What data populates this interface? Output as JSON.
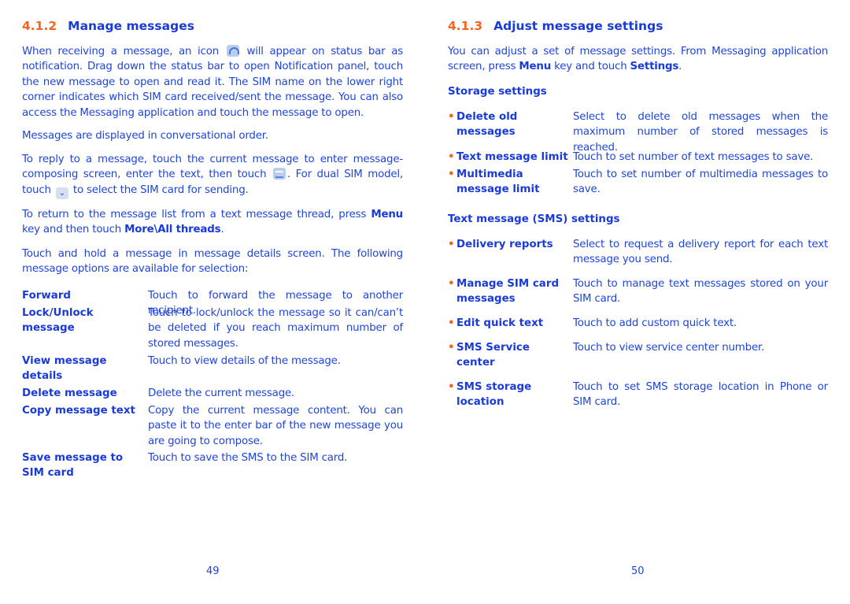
{
  "left_page": {
    "section_number": "4.1.2",
    "section_title": "Manage messages",
    "para1_before_icon": "When receiving a message, an icon",
    "para1_icon": "new-message-icon",
    "para1_after_icon": "will appear on status bar as notification. Drag down the status bar to open Notification panel, touch the new message to open and read it. The SIM name on the lower right corner indicates which SIM card received/sent the message. You can also access the Messaging application and touch the message to open.",
    "para2": "Messages are displayed in conversational order.",
    "para3_part1": "To reply to a message, touch the current message to enter message-composing screen, enter the text, then touch",
    "para3_icon1": "send-icon",
    "para3_part2": ". For dual SIM model, touch",
    "para3_icon2": "chevron-down-icon",
    "para3_part3": "to select the SIM card for sending.",
    "para4_part1": "To return to the message list from a text message thread, press",
    "para4_bold1": "Menu",
    "para4_part2": "key and then touch",
    "para4_bold2": "More\\All threads",
    "para4_part3": ".",
    "para5": "Touch and hold a message in message details screen. The following message options are available for selection:",
    "options": [
      {
        "term": "Forward",
        "desc": "Touch to forward the message to another recipient."
      },
      {
        "term": "Lock/Unlock message",
        "desc": "Touch to lock/unlock the message so it can/can’t be deleted if you reach maximum number of stored messages."
      },
      {
        "term": "View message details",
        "desc": "Touch to view details of the message."
      },
      {
        "term": "Delete message",
        "desc": "Delete the current message."
      },
      {
        "term": "Copy message text",
        "desc": "Copy the current message content. You can paste it to the enter bar of the new message you are going to compose."
      },
      {
        "term": "Save message to SIM card",
        "desc": "Touch to save the SMS to the SIM card."
      }
    ],
    "page_number": "49"
  },
  "right_page": {
    "section_number": "4.1.3",
    "section_title": "Adjust message settings",
    "intro_part1": "You can adjust a set of message settings. From Messaging application screen, press",
    "intro_bold1": "Menu",
    "intro_part2": "key and touch",
    "intro_bold2": "Settings",
    "intro_part3": ".",
    "storage_heading": "Storage settings",
    "storage_items": [
      {
        "term": "Delete old messages",
        "desc": "Select to delete old messages when the maximum number of stored messages is reached."
      },
      {
        "term": "Text message limit",
        "desc": "Touch to set number of text messages to save."
      },
      {
        "term": "Multimedia message limit",
        "desc": "Touch to set number of multimedia messages to save."
      }
    ],
    "sms_heading": "Text message (SMS) settings",
    "sms_items": [
      {
        "term": "Delivery reports",
        "desc": "Select to request a delivery report for each text message you send."
      },
      {
        "term": "Manage SIM card messages",
        "desc": "Touch to manage text messages stored on your SIM card."
      },
      {
        "term": "Edit quick text",
        "desc": "Touch to add custom quick text."
      },
      {
        "term": "SMS Service center",
        "desc": "Touch to view service center number."
      },
      {
        "term": "SMS storage location",
        "desc": "Touch to set SMS storage location in Phone or SIM card."
      }
    ],
    "bullet": "•",
    "page_number": "50"
  },
  "colors": {
    "section_number": "#f26522",
    "heading": "#1a3bd6",
    "body_text": "#1f45d8"
  }
}
